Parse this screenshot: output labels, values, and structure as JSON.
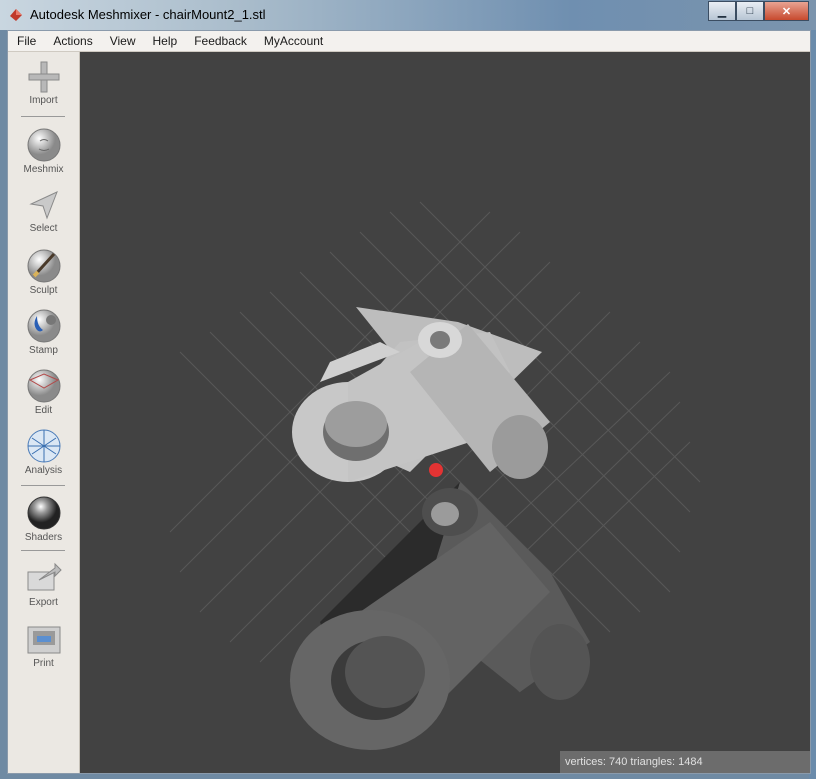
{
  "window": {
    "title": "Autodesk Meshmixer - chairMount2_1.stl"
  },
  "window_controls": {
    "minimize": "▁",
    "maximize": "□",
    "close": "✕"
  },
  "menu": [
    "File",
    "Actions",
    "View",
    "Help",
    "Feedback",
    "MyAccount"
  ],
  "tools": [
    {
      "label": "Import",
      "icon": "plus-icon"
    },
    {
      "label": "Meshmix",
      "icon": "face-sphere-icon"
    },
    {
      "label": "Select",
      "icon": "arrow-pointer-icon"
    },
    {
      "label": "Sculpt",
      "icon": "brush-sphere-icon"
    },
    {
      "label": "Stamp",
      "icon": "stamp-sphere-icon"
    },
    {
      "label": "Edit",
      "icon": "wireframe-sphere-icon"
    },
    {
      "label": "Analysis",
      "icon": "mesh-sphere-icon"
    },
    {
      "label": "Shaders",
      "icon": "chrome-sphere-icon"
    },
    {
      "label": "Export",
      "icon": "export-arrow-icon"
    },
    {
      "label": "Print",
      "icon": "printer-icon"
    }
  ],
  "status": {
    "text": "vertices: 740 triangles: 1484"
  },
  "colors": {
    "viewport_bg": "#424242",
    "pivot": "#e33333",
    "part_light": "#b9b9b9",
    "part_dark": "#5a5a5a"
  }
}
